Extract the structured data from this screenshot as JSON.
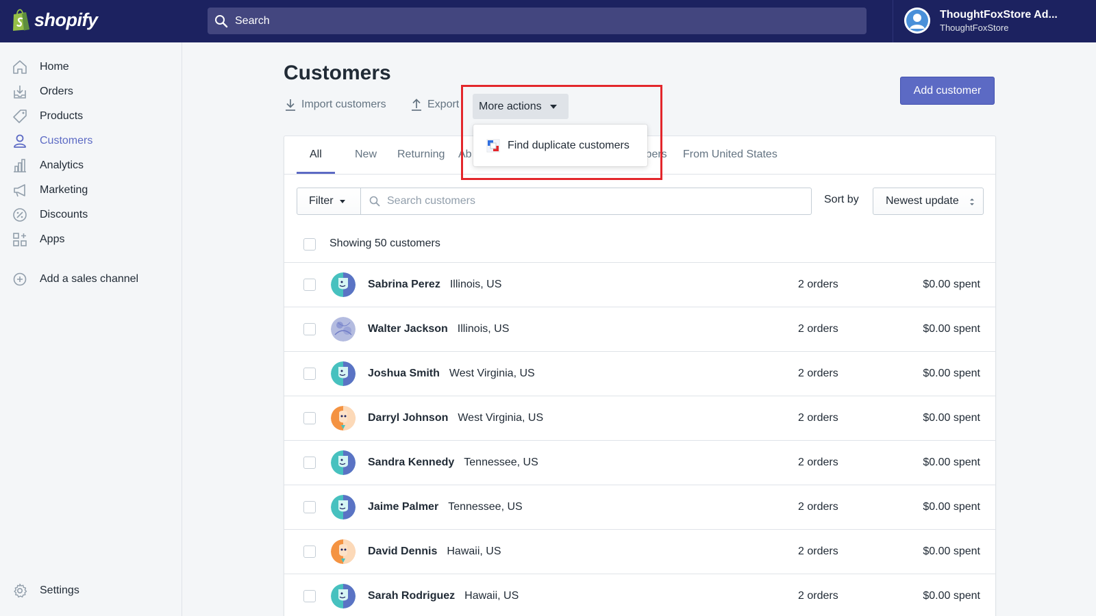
{
  "brand": {
    "logo_text": "shopify",
    "accent": "#5c6ac4",
    "topbar_color": "#1c2260"
  },
  "topbar": {
    "search_placeholder": "Search",
    "account_name": "ThoughtFoxStore Ad...",
    "store_name": "ThoughtFoxStore"
  },
  "sidebar": {
    "items": [
      {
        "label": "Home",
        "icon": "home-icon"
      },
      {
        "label": "Orders",
        "icon": "orders-icon"
      },
      {
        "label": "Products",
        "icon": "tag-icon"
      },
      {
        "label": "Customers",
        "icon": "person-icon",
        "active": true
      },
      {
        "label": "Analytics",
        "icon": "bar-chart-icon"
      },
      {
        "label": "Marketing",
        "icon": "megaphone-icon"
      },
      {
        "label": "Discounts",
        "icon": "discount-icon"
      },
      {
        "label": "Apps",
        "icon": "apps-icon"
      }
    ],
    "add_channel": "Add a sales channel",
    "settings": "Settings"
  },
  "page": {
    "title": "Customers",
    "import_label": "Import customers",
    "export_label": "Export",
    "more_actions_label": "More actions",
    "add_customer_label": "Add customer"
  },
  "dropdown": {
    "items": [
      {
        "label": "Find duplicate customers",
        "icon": "duplicate-app-icon"
      }
    ]
  },
  "tabs": [
    "All",
    "New",
    "Returning",
    "Ab",
    "ibers",
    "From United States"
  ],
  "filters": {
    "filter_label": "Filter",
    "search_placeholder": "Search customers",
    "sort_label": "Sort by",
    "sort_value": "Newest update"
  },
  "list": {
    "showing": "Showing 50 customers",
    "customers": [
      {
        "name": "Sabrina Perez",
        "location": "Illinois, US",
        "orders": "2 orders",
        "spent": "$0.00 spent",
        "avatar": "teal"
      },
      {
        "name": "Walter Jackson",
        "location": "Illinois, US",
        "orders": "2 orders",
        "spent": "$0.00 spent",
        "avatar": "photo"
      },
      {
        "name": "Joshua Smith",
        "location": "West Virginia, US",
        "orders": "2 orders",
        "spent": "$0.00 spent",
        "avatar": "teal"
      },
      {
        "name": "Darryl Johnson",
        "location": "West Virginia, US",
        "orders": "2 orders",
        "spent": "$0.00 spent",
        "avatar": "orange"
      },
      {
        "name": "Sandra Kennedy",
        "location": "Tennessee, US",
        "orders": "2 orders",
        "spent": "$0.00 spent",
        "avatar": "teal"
      },
      {
        "name": "Jaime Palmer",
        "location": "Tennessee, US",
        "orders": "2 orders",
        "spent": "$0.00 spent",
        "avatar": "teal"
      },
      {
        "name": "David Dennis",
        "location": "Hawaii, US",
        "orders": "2 orders",
        "spent": "$0.00 spent",
        "avatar": "orange"
      },
      {
        "name": "Sarah Rodriguez",
        "location": "Hawaii, US",
        "orders": "2 orders",
        "spent": "$0.00 spent",
        "avatar": "teal"
      }
    ]
  }
}
